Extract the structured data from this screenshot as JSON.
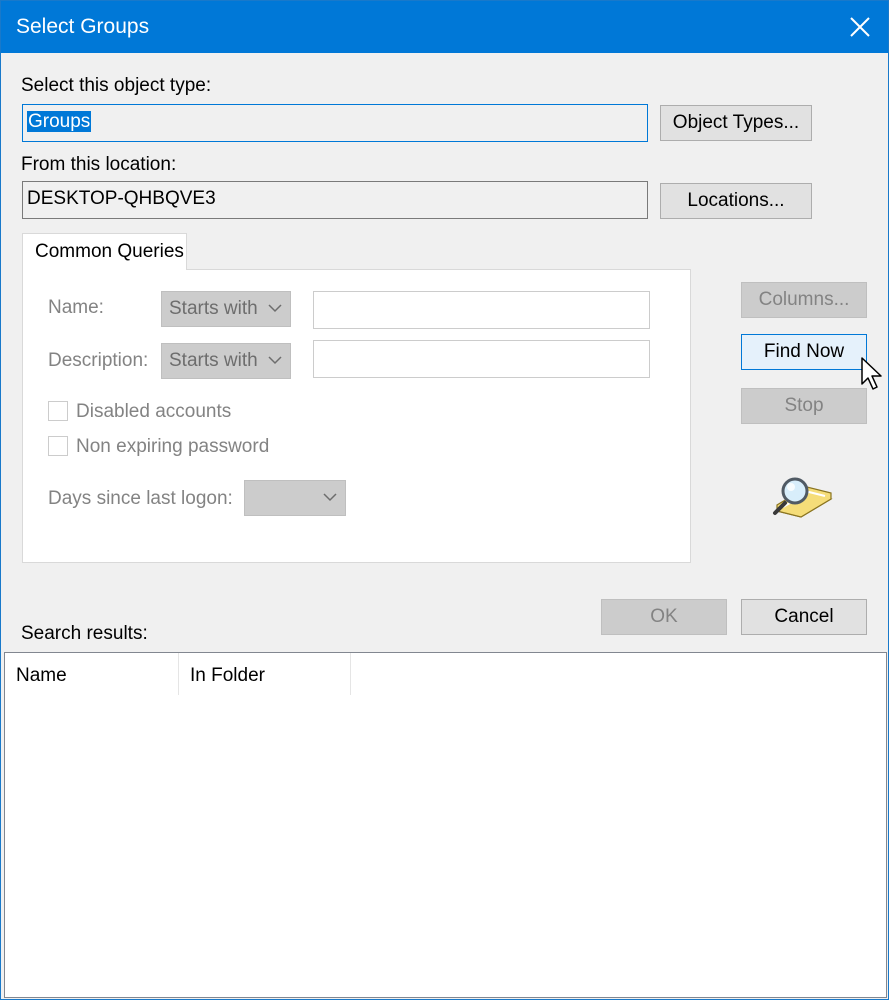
{
  "window": {
    "title": "Select Groups"
  },
  "object_type": {
    "label": "Select this object type:",
    "value": "Groups",
    "button": "Object Types..."
  },
  "location": {
    "label": "From this location:",
    "value": "DESKTOP-QHBQVE3",
    "button": "Locations..."
  },
  "tab": {
    "label": "Common Queries"
  },
  "query": {
    "name_label": "Name:",
    "name_mode": "Starts with",
    "description_label": "Description:",
    "description_mode": "Starts with",
    "disabled_accounts": "Disabled accounts",
    "non_expiring_password": "Non expiring password",
    "days_label": "Days since last logon:",
    "days_value": ""
  },
  "side_buttons": {
    "columns": "Columns...",
    "find_now": "Find Now",
    "stop": "Stop"
  },
  "dialog_buttons": {
    "ok": "OK",
    "cancel": "Cancel"
  },
  "results": {
    "label": "Search results:",
    "columns": [
      "Name",
      "In Folder"
    ]
  },
  "colors": {
    "titlebar": "#0078d7",
    "selection": "#0078d7",
    "dialog_bg": "#f0f0f0"
  },
  "icons": {
    "close": "close-icon",
    "search": "search-query-icon",
    "cursor": "mouse-pointer-icon"
  }
}
